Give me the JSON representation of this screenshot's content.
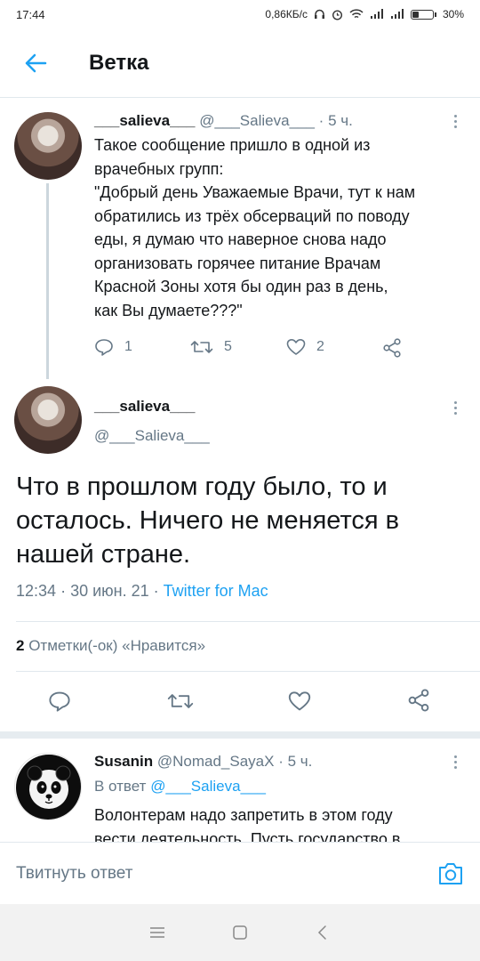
{
  "status": {
    "time": "17:44",
    "net_speed": "0,86КБ/с",
    "battery": "30%",
    "battery_level": 0.3
  },
  "header": {
    "title": "Ветка",
    "back_icon": "arrow-left-icon"
  },
  "tweets": [
    {
      "name": "___salieva___",
      "handle": "@___Salieva___",
      "sep": "·",
      "time": "5 ч.",
      "lines": [
        "Такое сообщение пришло в одной из",
        "врачебных групп:",
        "\"Добрый день Уважаемые Врачи, тут к нам",
        "обратились из трёх обсерваций по поводу",
        "еды, я думаю что наверное снова надо",
        "организовать горячее питание Врачам",
        "Красной Зоны хотя бы один раз в день,",
        "как Вы думаете???\""
      ],
      "replies": "1",
      "retweets": "5",
      "likes": "2"
    }
  ],
  "main_tweet": {
    "name": "___salieva___",
    "handle": "@___Salieva___",
    "lines": [
      "Что в прошлом году было, то и",
      "осталось. Ничего не меняется в",
      "нашей стране."
    ],
    "time": "12:34",
    "sep": "·",
    "date": "30 июн. 21",
    "source": "Twitter for Mac",
    "likes_count": "2",
    "likes_label": "Отметки(-ок) «Нравится»"
  },
  "reply_tweet": {
    "name": "Susanin",
    "handle": "@Nomad_SayaX",
    "sep": "·",
    "time": "5 ч.",
    "in_reply_prefix": "В ответ",
    "in_reply_handle": "@___Salieva___",
    "lines": [
      "Волонтерам надо запретить в этом году",
      "вести деятельность. Пусть государство в"
    ]
  },
  "reply_bar": {
    "placeholder": "Твитнуть ответ",
    "camera_icon": "camera-icon"
  },
  "colors": {
    "accent": "#1da1f2",
    "text": "#14171a",
    "muted": "#657786",
    "divider": "#e1e8ed"
  }
}
